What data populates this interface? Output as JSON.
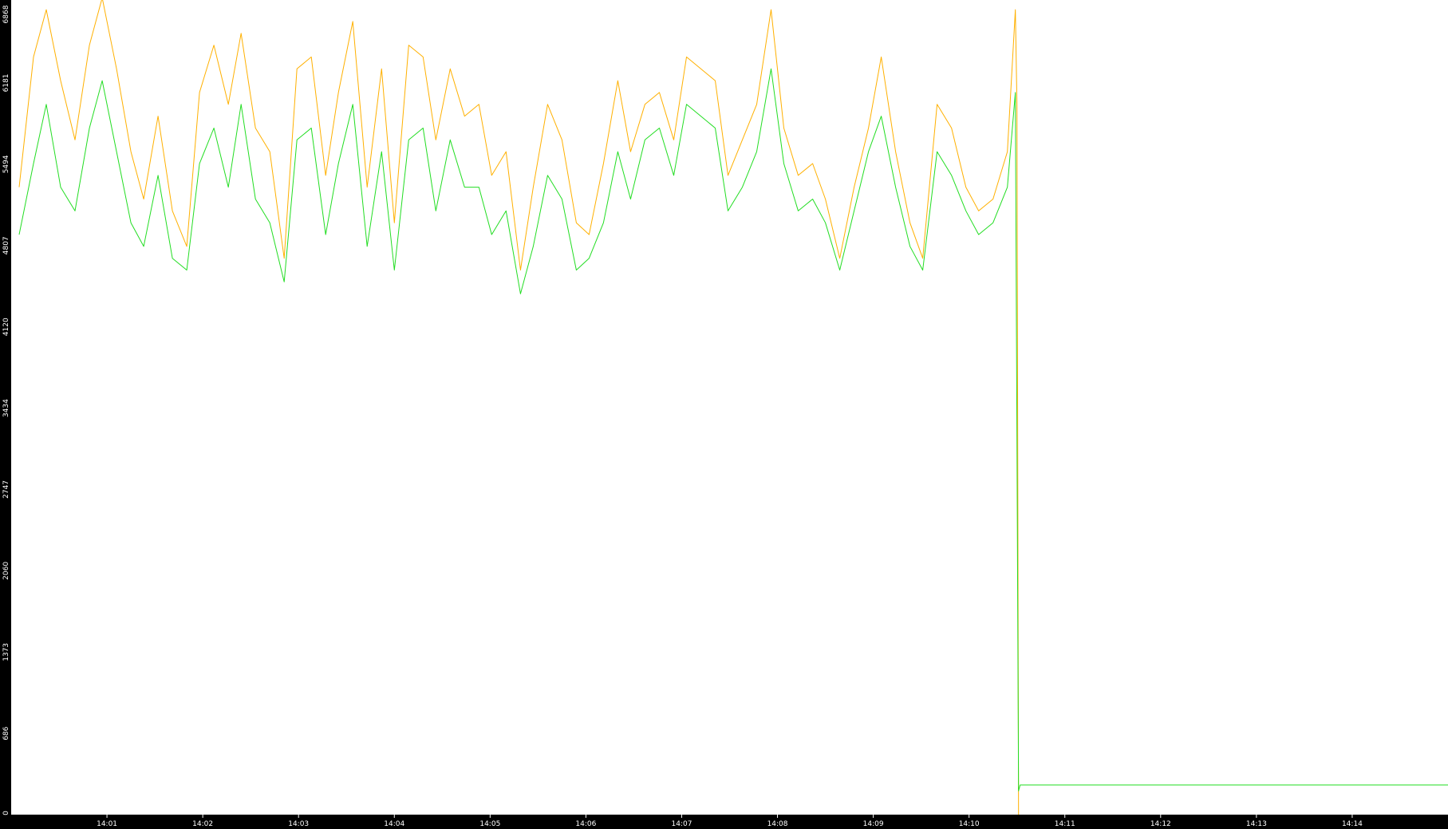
{
  "chart_data": {
    "type": "line",
    "title": "",
    "xlabel": "",
    "ylabel": "",
    "ylim": [
      0,
      6868
    ],
    "xlim": [
      "14:00:00",
      "14:15:00"
    ],
    "y_ticks": [
      "6868",
      "6181",
      "5494",
      "4807",
      "4120",
      "3434",
      "2747",
      "2060",
      "1373",
      "686",
      "0"
    ],
    "x_ticks": [
      "14:01",
      "14:02",
      "14:03",
      "14:04",
      "14:05",
      "14:06",
      "14:07",
      "14:08",
      "14:09",
      "14:10",
      "14:11",
      "14:12",
      "14:13",
      "14:14"
    ],
    "grid": false,
    "legend": "none",
    "colors": {
      "axis_strip": "#000000",
      "axis_text": "#ffffff",
      "series_orange": "#ffb000",
      "series_green": "#22dd22",
      "background": "#ffffff"
    },
    "series": [
      {
        "color": "#ffb000",
        "x": [
          "14:00:05",
          "14:00:14",
          "14:00:22",
          "14:00:31",
          "14:00:40",
          "14:00:49",
          "14:00:57",
          "14:01:06",
          "14:01:15",
          "14:01:23",
          "14:01:32",
          "14:01:41",
          "14:01:50",
          "14:01:58",
          "14:02:07",
          "14:02:16",
          "14:02:24",
          "14:02:33",
          "14:02:42",
          "14:02:51",
          "14:02:59",
          "14:03:08",
          "14:03:17",
          "14:03:25",
          "14:03:34",
          "14:03:43",
          "14:03:52",
          "14:04:00",
          "14:04:09",
          "14:04:18",
          "14:04:26",
          "14:04:35",
          "14:04:44",
          "14:04:53",
          "14:05:01",
          "14:05:10",
          "14:05:19",
          "14:05:27",
          "14:05:36",
          "14:05:45",
          "14:05:54",
          "14:06:02",
          "14:06:11",
          "14:06:20",
          "14:06:28",
          "14:06:37",
          "14:06:46",
          "14:06:55",
          "14:07:03",
          "14:07:12",
          "14:07:21",
          "14:07:29",
          "14:07:38",
          "14:07:47",
          "14:07:56",
          "14:08:04",
          "14:08:13",
          "14:08:22",
          "14:08:30",
          "14:08:39",
          "14:08:48",
          "14:08:57",
          "14:09:05",
          "14:09:14",
          "14:09:23",
          "14:09:31",
          "14:09:40",
          "14:09:49",
          "14:09:58",
          "14:10:06",
          "14:10:15",
          "14:10:24",
          "14:10:29",
          "14:10:30",
          "14:10:31"
        ],
        "values": [
          5300,
          6400,
          6800,
          6200,
          5700,
          6500,
          6900,
          6300,
          5600,
          5200,
          5900,
          5100,
          4800,
          6100,
          6500,
          6000,
          6600,
          5800,
          5600,
          4700,
          6300,
          6400,
          5400,
          6100,
          6700,
          5300,
          6300,
          5000,
          6500,
          6400,
          5700,
          6300,
          5900,
          6000,
          5400,
          5600,
          4600,
          5300,
          6000,
          5700,
          5000,
          4900,
          5500,
          6200,
          5600,
          6000,
          6100,
          5700,
          6400,
          6300,
          6200,
          5400,
          5700,
          6000,
          6800,
          5800,
          5400,
          5500,
          5200,
          4700,
          5300,
          5800,
          6400,
          5600,
          5000,
          4700,
          6000,
          5800,
          5300,
          5100,
          5200,
          5600,
          6800,
          6000,
          0
        ]
      },
      {
        "color": "#22dd22",
        "x": [
          "14:00:05",
          "14:00:14",
          "14:00:22",
          "14:00:31",
          "14:00:40",
          "14:00:49",
          "14:00:57",
          "14:01:06",
          "14:01:15",
          "14:01:23",
          "14:01:32",
          "14:01:41",
          "14:01:50",
          "14:01:58",
          "14:02:07",
          "14:02:16",
          "14:02:24",
          "14:02:33",
          "14:02:42",
          "14:02:51",
          "14:02:59",
          "14:03:08",
          "14:03:17",
          "14:03:25",
          "14:03:34",
          "14:03:43",
          "14:03:52",
          "14:04:00",
          "14:04:09",
          "14:04:18",
          "14:04:26",
          "14:04:35",
          "14:04:44",
          "14:04:53",
          "14:05:01",
          "14:05:10",
          "14:05:19",
          "14:05:27",
          "14:05:36",
          "14:05:45",
          "14:05:54",
          "14:06:02",
          "14:06:11",
          "14:06:20",
          "14:06:28",
          "14:06:37",
          "14:06:46",
          "14:06:55",
          "14:07:03",
          "14:07:12",
          "14:07:21",
          "14:07:29",
          "14:07:38",
          "14:07:47",
          "14:07:56",
          "14:08:04",
          "14:08:13",
          "14:08:22",
          "14:08:30",
          "14:08:39",
          "14:08:48",
          "14:08:57",
          "14:09:05",
          "14:09:14",
          "14:09:23",
          "14:09:31",
          "14:09:40",
          "14:09:49",
          "14:09:58",
          "14:10:06",
          "14:10:15",
          "14:10:24",
          "14:10:29",
          "14:10:30",
          "14:10:31",
          "14:10:32",
          "14:15:00"
        ],
        "values": [
          4900,
          5500,
          6000,
          5300,
          5100,
          5800,
          6200,
          5600,
          5000,
          4800,
          5400,
          4700,
          4600,
          5500,
          5800,
          5300,
          6000,
          5200,
          5000,
          4500,
          5700,
          5800,
          4900,
          5500,
          6000,
          4800,
          5600,
          4600,
          5700,
          5800,
          5100,
          5700,
          5300,
          5300,
          4900,
          5100,
          4400,
          4800,
          5400,
          5200,
          4600,
          4700,
          5000,
          5600,
          5200,
          5700,
          5800,
          5400,
          6000,
          5900,
          5800,
          5100,
          5300,
          5600,
          6300,
          5500,
          5100,
          5200,
          5000,
          4600,
          5100,
          5600,
          5900,
          5300,
          4800,
          4600,
          5600,
          5400,
          5100,
          4900,
          5000,
          5300,
          6100,
          3200,
          200,
          250,
          250
        ]
      }
    ]
  }
}
